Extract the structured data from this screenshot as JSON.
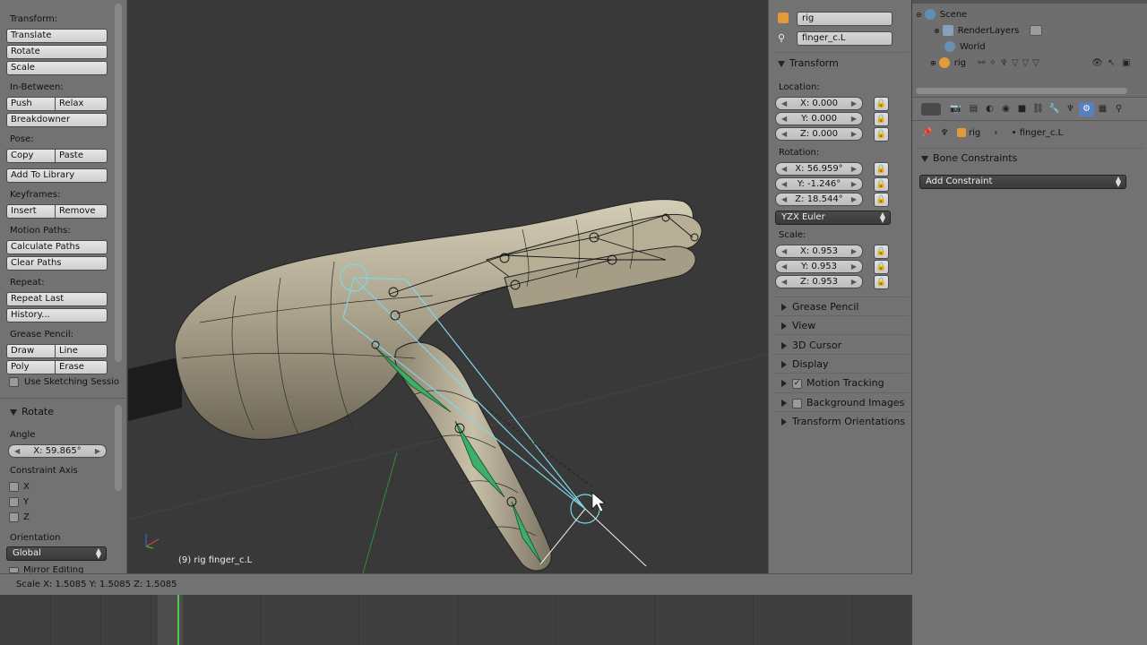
{
  "toolshelf": {
    "transform_label": "Transform:",
    "translate": "Translate",
    "rotate": "Rotate",
    "scale": "Scale",
    "inbetween_label": "In-Between:",
    "push": "Push",
    "relax": "Relax",
    "breakdowner": "Breakdowner",
    "pose_label": "Pose:",
    "copy": "Copy",
    "paste": "Paste",
    "add_to_library": "Add To Library",
    "keyframes_label": "Keyframes:",
    "insert": "Insert",
    "remove": "Remove",
    "motion_paths_label": "Motion Paths:",
    "calculate_paths": "Calculate Paths",
    "clear_paths": "Clear Paths",
    "repeat_label": "Repeat:",
    "repeat_last": "Repeat Last",
    "history": "History...",
    "grease_pencil_label": "Grease Pencil:",
    "draw": "Draw",
    "line": "Line",
    "poly": "Poly",
    "erase": "Erase",
    "use_sketching": "Use Sketching Sessio"
  },
  "operator": {
    "title": "Rotate",
    "angle_label": "Angle",
    "angle_value": "X: 59.865°",
    "constraint_axis_label": "Constraint Axis",
    "axis_x": "X",
    "axis_y": "Y",
    "axis_z": "Z",
    "orientation_label": "Orientation",
    "orientation_value": "Global",
    "mirror_editing": "Mirror Editing"
  },
  "viewport": {
    "info": "(9) rig finger_c.L"
  },
  "npanel": {
    "object_name": "rig",
    "bone_name": "finger_c.L",
    "transform_title": "Transform",
    "location_label": "Location:",
    "loc_x": "X: 0.000",
    "loc_y": "Y: 0.000",
    "loc_z": "Z: 0.000",
    "rotation_label": "Rotation:",
    "rot_x": "X: 56.959°",
    "rot_y": "Y: -1.246°",
    "rot_z": "Z: 18.544°",
    "rotation_mode": "YZX Euler",
    "scale_label": "Scale:",
    "scale_x": "X: 0.953",
    "scale_y": "Y: 0.953",
    "scale_z": "Z: 0.953",
    "grease_pencil": "Grease Pencil",
    "view": "View",
    "cursor_3d": "3D Cursor",
    "display": "Display",
    "motion_tracking": "Motion Tracking",
    "background_images": "Background Images",
    "transform_orientations": "Transform Orientations"
  },
  "outliner": {
    "scene": "Scene",
    "render_layers": "RenderLayers",
    "world": "World",
    "rig": "rig"
  },
  "properties": {
    "breadcrumb_object": "rig",
    "breadcrumb_bone": "finger_c.L",
    "bone_constraints_title": "Bone Constraints",
    "add_constraint": "Add Constraint"
  },
  "statusbar": {
    "text": "Scale X: 1.5085   Y: 1.5085   Z: 1.5085"
  },
  "colors": {
    "bone_selected": "#7fd6e8",
    "bone_green": "#3fae6a",
    "mesh": "#b8b09a",
    "active_tab": "#5680c2",
    "timeline_frame": "#52c84f"
  }
}
